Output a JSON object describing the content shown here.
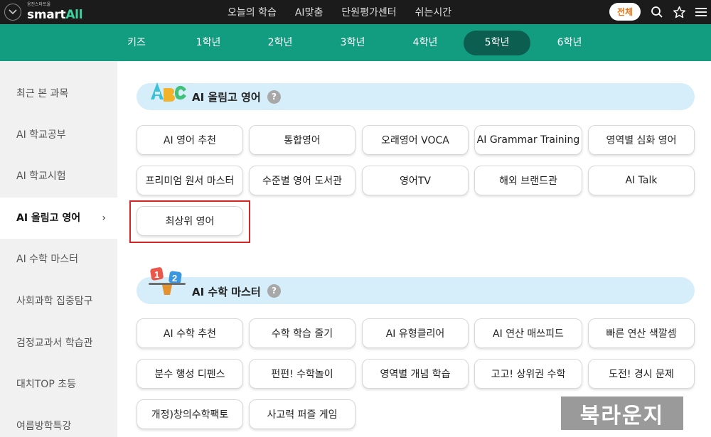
{
  "header": {
    "logo_sub": "웅진스마트올",
    "logo_main": "smart",
    "logo_accent": "All",
    "nav": [
      "오늘의 학습",
      "AI맞춤",
      "단원평가센터",
      "쉬는시간"
    ],
    "all_button": "전체"
  },
  "grades": [
    "키즈",
    "1학년",
    "2학년",
    "3학년",
    "4학년",
    "5학년",
    "6학년"
  ],
  "active_grade": "5학년",
  "sidebar": {
    "items": [
      "최근 본 과목",
      "AI 학교공부",
      "AI 학교시험",
      "AI 올림고 영어",
      "AI 수학 마스터",
      "사회과학 집중탐구",
      "검정교과서 학습관",
      "대치TOP 초등",
      "여름방학특강"
    ],
    "active_chevron": "›"
  },
  "sections": {
    "english": {
      "title": "AI 올림고 영어",
      "help": "?",
      "buttons": [
        "AI 영어 추천",
        "통합영어",
        "오래영어 VOCA",
        "AI Grammar Training",
        "영역별 심화 영어",
        "프리미엄 원서 마스터",
        "수준별 영어 도서관",
        "영어TV",
        "해외 브랜드관",
        "AI Talk",
        "최상위 영어"
      ]
    },
    "math": {
      "title": "AI 수학 마스터",
      "help": "?",
      "buttons": [
        "AI 수학 추천",
        "수학 학습 줄기",
        "AI 유형클리어",
        "AI 연산 매쓰피드",
        "빠른 연산 색깔셈",
        "분수 행성 디펜스",
        "펀펀! 수학놀이",
        "영역별 개념 학습",
        "고고! 상위권 수학",
        "도전! 경시 문제",
        "개정)창의수학팩토",
        "사고력 퍼즐 게임"
      ]
    }
  },
  "watermark": "북라운지",
  "colors": {
    "topbar": "#1b1b1b",
    "gradebar": "#129c80",
    "active_grade": "#0c5f50",
    "section_bar": "#d5eefa",
    "highlight": "#d42626",
    "all_button_text": "#e8771a"
  }
}
